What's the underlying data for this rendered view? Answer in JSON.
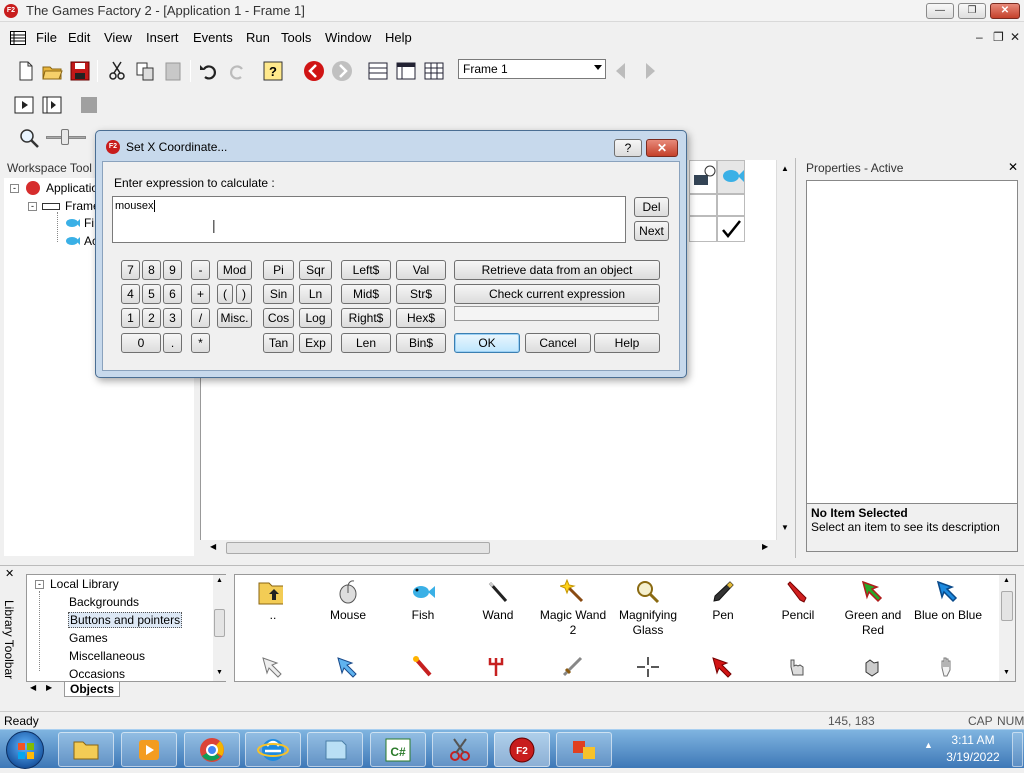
{
  "window": {
    "title": "The Games Factory 2 - [Application 1 - Frame 1]",
    "app_icon_text": "F2"
  },
  "menu": [
    "File",
    "Edit",
    "View",
    "Insert",
    "Events",
    "Run",
    "Tools",
    "Window",
    "Help"
  ],
  "toolbar": {
    "frame_select_value": "Frame 1"
  },
  "workspace": {
    "title": "Workspace Tool",
    "tree": [
      "Applicatio",
      "Frame",
      "Fi",
      "Ac"
    ]
  },
  "properties": {
    "title": "Properties - Active",
    "no_item_title": "No Item Selected",
    "no_item_desc": "Select an item to see its description"
  },
  "library": {
    "sidebar_label": "Library Toolbar",
    "tree": [
      "Local Library",
      "Backgrounds",
      "Buttons and pointers",
      "Games",
      "Miscellaneous",
      "Occasions"
    ],
    "tab_label": "Objects",
    "items_row1": [
      {
        "label": "..",
        "icon": "folder-up-icon"
      },
      {
        "label": "Mouse",
        "icon": "mouse-icon"
      },
      {
        "label": "Fish",
        "icon": "fish-icon"
      },
      {
        "label": "Wand",
        "icon": "wand-icon"
      },
      {
        "label": "Magic Wand 2",
        "icon": "magic-wand-icon"
      },
      {
        "label": "Magnifying Glass",
        "icon": "magnifying-glass-icon"
      },
      {
        "label": "Pen",
        "icon": "pen-icon"
      },
      {
        "label": "Pencil",
        "icon": "pencil-icon"
      },
      {
        "label": "Green and Red",
        "icon": "green-red-arrow-icon"
      },
      {
        "label": "Blue on Blue",
        "icon": "blue-arrow-icon"
      }
    ]
  },
  "status": {
    "left": "Ready",
    "coords": "145, 183",
    "caps": "CAP",
    "num": "NUM"
  },
  "taskbar": {
    "time": "3:11 AM",
    "date": "3/19/2022"
  },
  "dialog": {
    "title": "Set X Coordinate...",
    "prompt": "Enter expression to calculate :",
    "expression": "mousex",
    "side_buttons": [
      "Del",
      "Next"
    ],
    "keypad": [
      [
        "7",
        "8",
        "9",
        "-",
        "Mod"
      ],
      [
        "4",
        "5",
        "6",
        "+",
        "(",
        ")"
      ],
      [
        "1",
        "2",
        "3",
        "/",
        "Misc."
      ],
      [
        "0",
        ".",
        "*"
      ]
    ],
    "functions": [
      [
        "Pi",
        "Sqr",
        "Left$",
        "Val"
      ],
      [
        "Sin",
        "Ln",
        "Mid$",
        "Str$"
      ],
      [
        "Cos",
        "Log",
        "Right$",
        "Hex$"
      ],
      [
        "Tan",
        "Exp",
        "Len",
        "Bin$"
      ]
    ],
    "retrieve_label": "Retrieve data from an object",
    "check_label": "Check current expression",
    "ok_label": "OK",
    "cancel_label": "Cancel",
    "help_label": "Help",
    "help_icon": "?",
    "colors": {
      "accent": "#3c7fb1",
      "frame": "#c7d9ec"
    }
  }
}
